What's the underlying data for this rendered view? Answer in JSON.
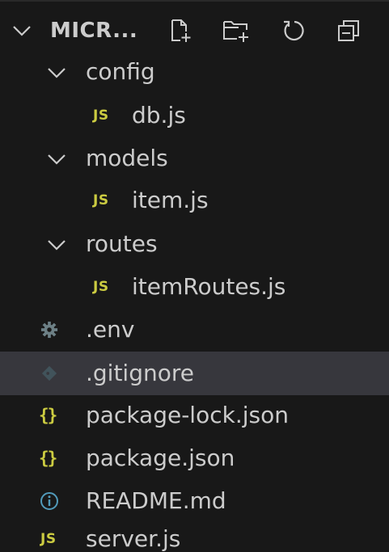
{
  "header": {
    "title": "MICR...",
    "icons": [
      "new-file-icon",
      "new-folder-icon",
      "refresh-icon",
      "collapse-all-icon"
    ]
  },
  "tree": {
    "folders": {
      "config": "config",
      "models": "models",
      "routes": "routes"
    },
    "files": {
      "db": "db.js",
      "item": "item.js",
      "itemRoutes": "itemRoutes.js",
      "env": ".env",
      "gitignore": ".gitignore",
      "package_lock": "package-lock.json",
      "package": "package.json",
      "readme": "README.md",
      "server": "server.js"
    },
    "badges": {
      "js": "JS",
      "json": "{}"
    },
    "selected": ".gitignore"
  },
  "colors": {
    "background": "#181818",
    "selected_row": "#37373d",
    "text": "#cccccc",
    "js_badge": "#cbcb41",
    "json_badge": "#cbcb41",
    "info_icon": "#519aba",
    "gear_icon": "#6d8086",
    "git_icon": "#41535b"
  }
}
